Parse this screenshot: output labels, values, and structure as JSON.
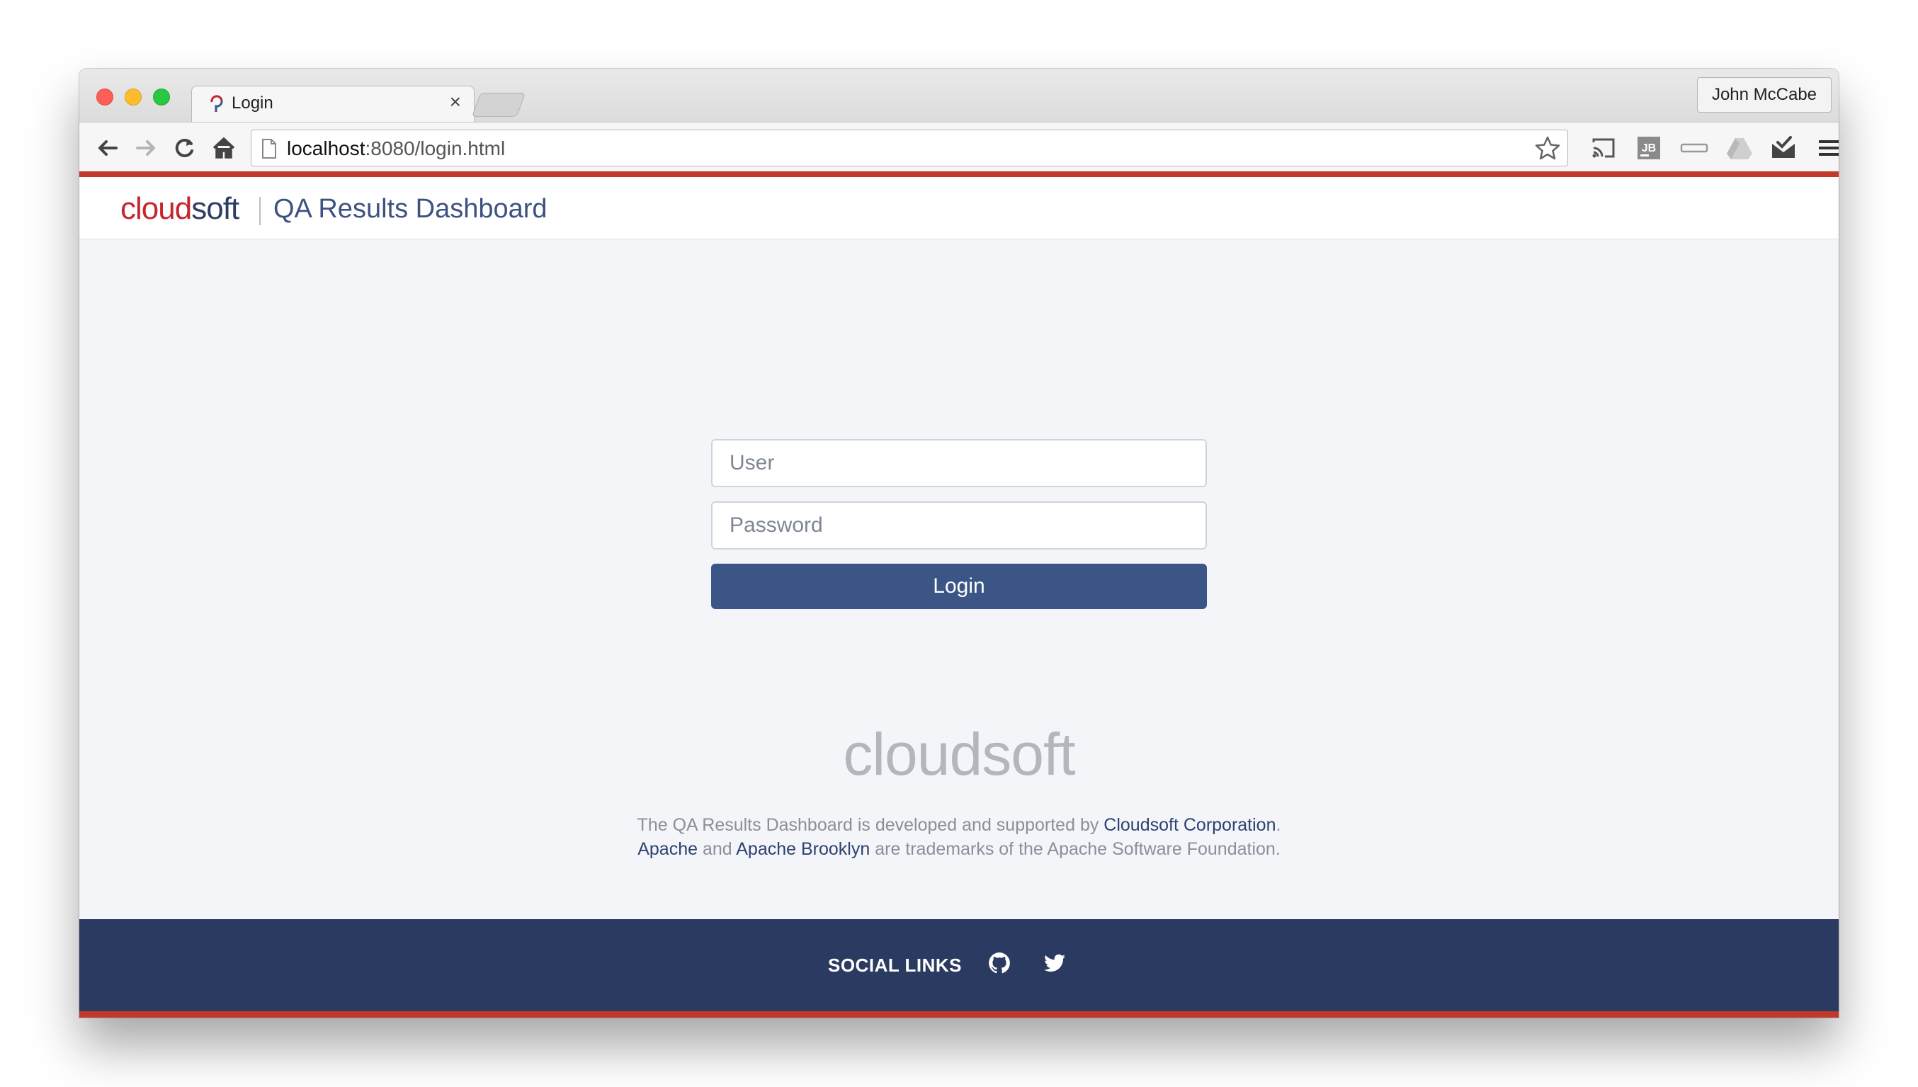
{
  "window": {
    "tab_title": "Login",
    "tab_close": "×",
    "profile_name": "John McCabe",
    "url_host": "localhost",
    "url_rest": ":8080/login.html"
  },
  "header": {
    "brand_part1": "cl",
    "brand_part2": "o",
    "brand_part3": "ud",
    "brand_part4": "soft",
    "title": "QA Results Dashboard"
  },
  "login": {
    "user_placeholder": "User",
    "password_placeholder": "Password",
    "button_label": "Login"
  },
  "footer": {
    "logo_text": "cloudsoft",
    "line1_prefix": "The QA Results Dashboard is developed and supported by ",
    "line1_link": "Cloudsoft Corporation",
    "line1_suffix": ".",
    "line2_link1": "Apache",
    "line2_and": " and ",
    "line2_link2": "Apache Brooklyn",
    "line2_suffix": " are trademarks of the Apache Software Foundation."
  },
  "social": {
    "label": "SOCIAL LINKS",
    "icons": [
      "github-icon",
      "twitter-icon"
    ]
  },
  "colors": {
    "accent_red": "#c0392b",
    "primary_blue": "#3b5586",
    "footer_navy": "#2b3a61"
  }
}
